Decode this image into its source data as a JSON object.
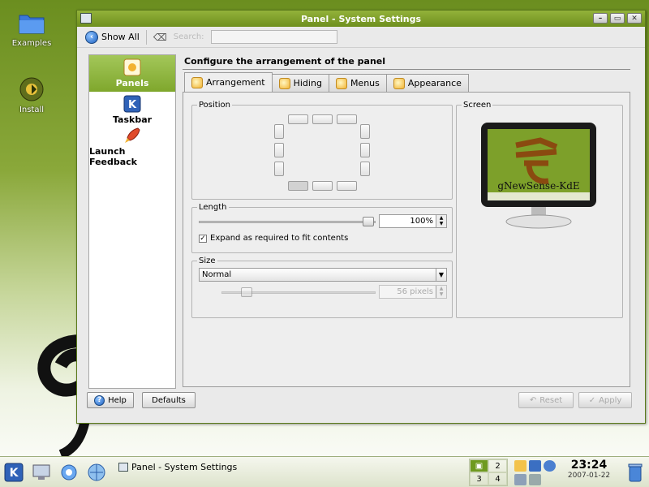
{
  "desktop": {
    "icons": [
      {
        "label": "Examples"
      },
      {
        "label": "Install"
      }
    ]
  },
  "window": {
    "title": "Panel - System Settings",
    "toolbar": {
      "show_all": "Show All",
      "search_label": "Search:",
      "search_value": ""
    },
    "sidebar": {
      "items": [
        {
          "label": "Panels",
          "active": true
        },
        {
          "label": "Taskbar",
          "active": false
        },
        {
          "label": "Launch Feedback",
          "active": false
        }
      ]
    },
    "content_title": "Configure the arrangement of the panel",
    "tabs": [
      {
        "label": "Arrangement",
        "active": true
      },
      {
        "label": "Hiding",
        "active": false
      },
      {
        "label": "Menus",
        "active": false
      },
      {
        "label": "Appearance",
        "active": false
      }
    ],
    "position_group": {
      "label": "Position"
    },
    "length_group": {
      "label": "Length",
      "value": "100%",
      "slider_fraction": 1.0,
      "expand_checkbox": {
        "label": "Expand as required to fit contents",
        "checked": true
      }
    },
    "size_group": {
      "label": "Size",
      "select_value": "Normal",
      "spin_value": "56 pixels"
    },
    "screen_group": {
      "label": "Screen",
      "preview_text": "gNewSense-KdE"
    },
    "buttons": {
      "help": "Help",
      "defaults": "Defaults",
      "reset": "Reset",
      "apply": "Apply"
    }
  },
  "taskbar": {
    "task_title": "Panel - System Settings",
    "pager": [
      "1",
      "2",
      "3",
      "4"
    ],
    "time": "23:24",
    "date": "2007-01-22"
  }
}
